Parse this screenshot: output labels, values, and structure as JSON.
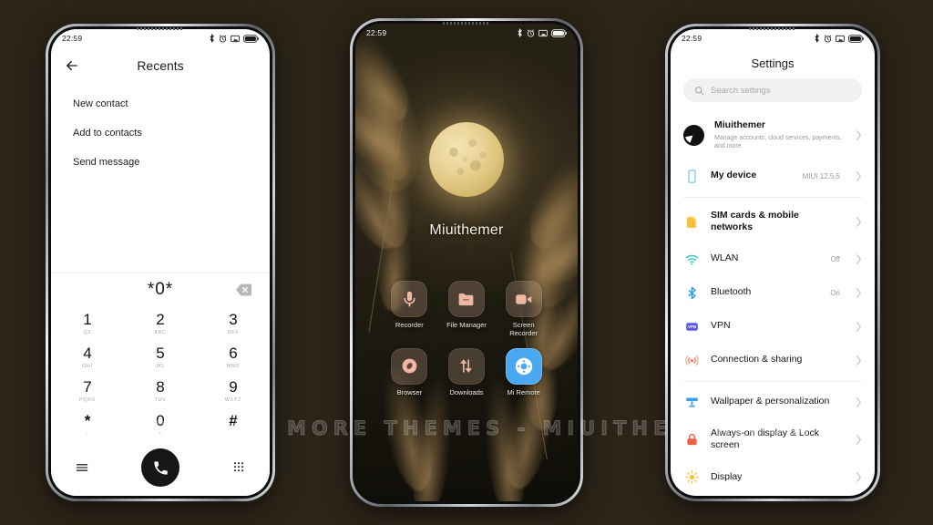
{
  "background_color": "#2b2418",
  "watermark": {
    "text": "VISIT FOR MORE THEMES - MIUITHEMER.COM"
  },
  "status_bar": {
    "time": "22:59",
    "icons": [
      "bluetooth-icon",
      "alarm-icon",
      "screenshot-icon",
      "battery-icon"
    ]
  },
  "phone_left": {
    "app": "Dialer",
    "topbar": {
      "title": "Recents",
      "back_icon": "back-arrow-icon"
    },
    "actions": [
      {
        "label": "New contact"
      },
      {
        "label": "Add to contacts"
      },
      {
        "label": "Send message"
      }
    ],
    "dialer": {
      "number": "*0*",
      "backspace_icon": "backspace-icon",
      "keys": [
        {
          "num": "1",
          "sub": "QZ"
        },
        {
          "num": "2",
          "sub": "ABC"
        },
        {
          "num": "3",
          "sub": "DEF"
        },
        {
          "num": "4",
          "sub": "GHI"
        },
        {
          "num": "5",
          "sub": "JKL"
        },
        {
          "num": "6",
          "sub": "MNO"
        },
        {
          "num": "7",
          "sub": "PQRS"
        },
        {
          "num": "8",
          "sub": "TUV"
        },
        {
          "num": "9",
          "sub": "WXYZ"
        },
        {
          "num": "*",
          "sub": ","
        },
        {
          "num": "0",
          "sub": "+"
        },
        {
          "num": "#",
          "sub": ""
        }
      ],
      "actions": {
        "menu_icon": "hamburger-menu-icon",
        "call_icon": "call-handset-icon",
        "keypad_icon": "keypad-dots-icon"
      }
    }
  },
  "phone_center": {
    "app": "Home screen",
    "wallpaper": "full-moon-night-with-pampas-grass",
    "widget_label": "Miuithemer",
    "apps": [
      {
        "name": "Recorder",
        "icon": "microphone-icon",
        "style": "translucent"
      },
      {
        "name": "File Manager",
        "icon": "folder-icon",
        "style": "translucent"
      },
      {
        "name": "Screen Recorder",
        "icon": "video-camera-icon",
        "style": "translucent"
      },
      {
        "name": "Browser",
        "icon": "compass-icon",
        "style": "translucent"
      },
      {
        "name": "Downloads",
        "icon": "up-down-arrows-icon",
        "style": "translucent"
      },
      {
        "name": "Mi Remote",
        "icon": "remote-dpad-icon",
        "style": "blue",
        "color": "#4aa8f0"
      }
    ]
  },
  "phone_right": {
    "app": "Settings",
    "title": "Settings",
    "search": {
      "placeholder": "Search settings",
      "icon": "search-icon"
    },
    "account": {
      "name": "Miuithemer",
      "subtitle": "Manage accounts, cloud services, payments, and more",
      "avatar": "user-avatar"
    },
    "items": [
      {
        "label": "My device",
        "value": "MIUI 12.5.5",
        "icon": "phone-outline-icon",
        "color": "#7fc4ef"
      },
      {
        "label": "SIM cards & mobile networks",
        "value": "",
        "icon": "sim-card-icon",
        "color": "#f5c13b"
      },
      {
        "label": "WLAN",
        "value": "Off",
        "icon": "wifi-icon",
        "color": "#35c4c4"
      },
      {
        "label": "Bluetooth",
        "value": "On",
        "icon": "bluetooth-icon",
        "color": "#2d9cf0"
      },
      {
        "label": "VPN",
        "value": "",
        "icon": "vpn-badge-icon",
        "color": "#5b5bef"
      },
      {
        "label": "Connection & sharing",
        "value": "",
        "icon": "connection-sharing-icon",
        "color": "#ef7a5a"
      },
      {
        "label": "Wallpaper & personalization",
        "value": "",
        "icon": "wallpaper-icon",
        "color": "#3fa0e8"
      },
      {
        "label": "Always-on display & Lock screen",
        "value": "",
        "icon": "lock-icon",
        "color": "#ef5f43"
      },
      {
        "label": "Display",
        "value": "",
        "icon": "brightness-sun-icon",
        "color": "#fbc02d"
      }
    ],
    "chevron_icon": "chevron-right-icon"
  }
}
